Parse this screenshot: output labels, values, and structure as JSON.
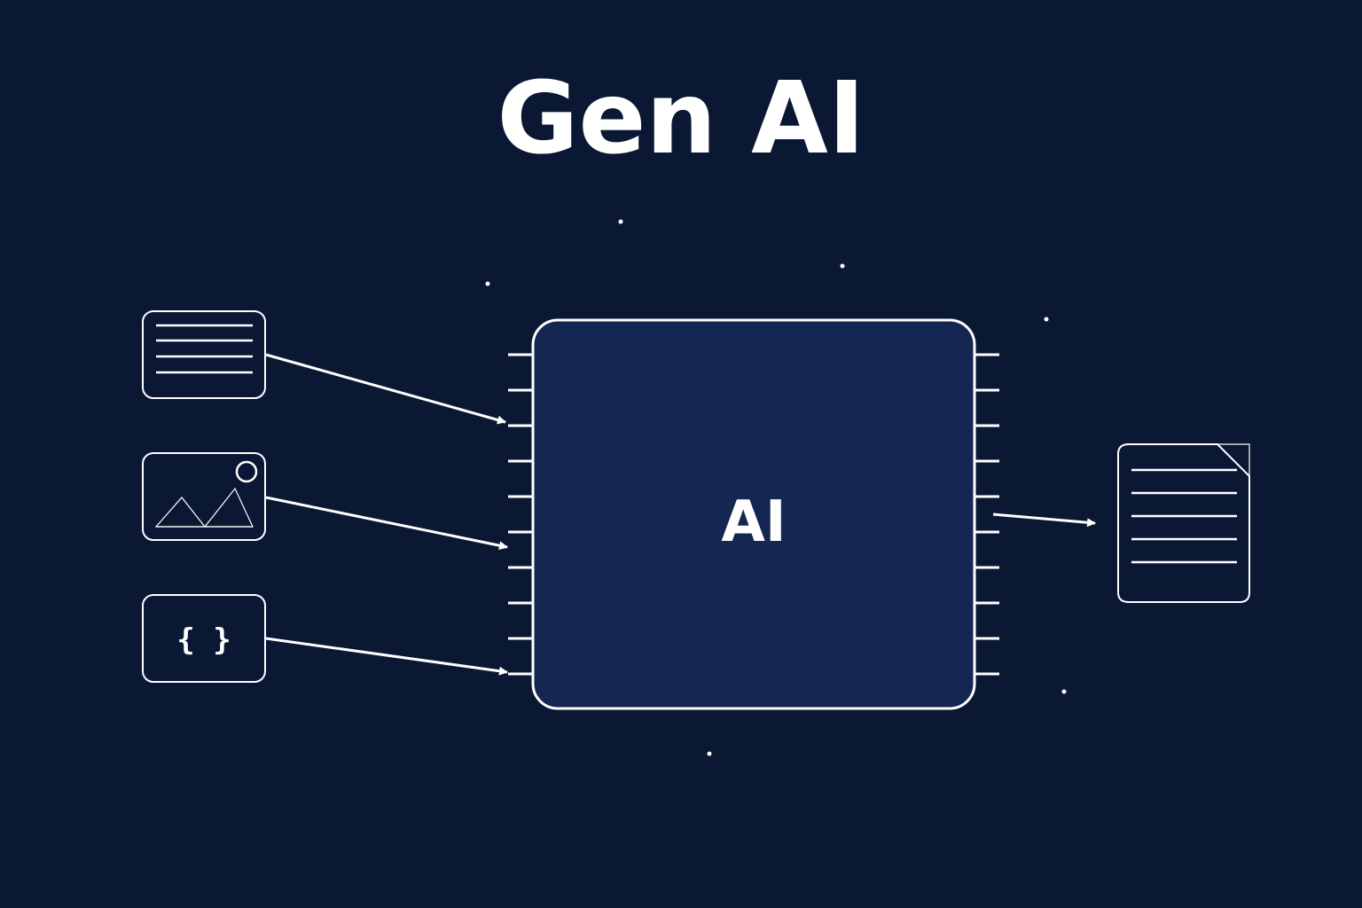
{
  "title": "Gen AI",
  "chip": {
    "label": "AI"
  },
  "inputs": [
    {
      "kind": "text-document",
      "icon": "text-lines-icon"
    },
    {
      "kind": "image",
      "icon": "image-mountain-icon"
    },
    {
      "kind": "code",
      "icon": "code-braces-icon",
      "label": "{ }"
    }
  ],
  "output": {
    "kind": "generated-document",
    "icon": "document-page-icon"
  },
  "colors": {
    "background": "#0b1834",
    "chip_fill": "#132752",
    "stroke": "#ffffff",
    "text": "#ffffff"
  }
}
